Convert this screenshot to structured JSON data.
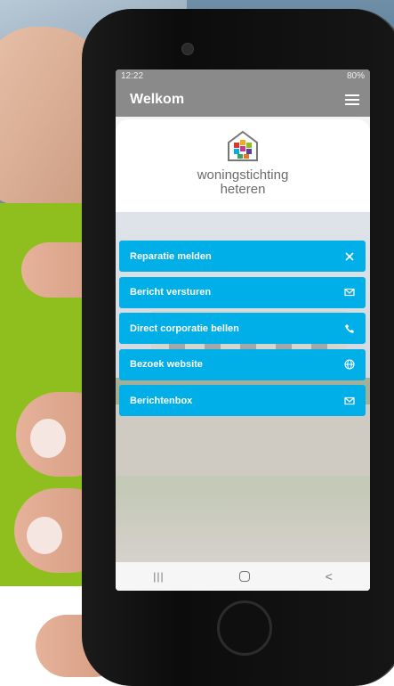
{
  "status_bar": {
    "time": "12:22",
    "battery": "80%"
  },
  "app_bar": {
    "title": "Welkom",
    "menu_icon": "hamburger-menu-icon"
  },
  "logo": {
    "line1": "woningstichting",
    "line2": "heteren"
  },
  "actions": [
    {
      "label": "Reparatie melden",
      "icon": "tools-icon"
    },
    {
      "label": "Bericht versturen",
      "icon": "envelope-icon"
    },
    {
      "label": "Direct corporatie bellen",
      "icon": "phone-call-icon"
    },
    {
      "label": "Bezoek website",
      "icon": "globe-icon"
    },
    {
      "label": "Berichtenbox",
      "icon": "envelope-icon"
    }
  ],
  "nav": {
    "recent": "|||",
    "back": "<"
  },
  "colors": {
    "button": "#00aee8",
    "appbar": "#8a8a8a",
    "accent_green": "#8fbf1e"
  }
}
